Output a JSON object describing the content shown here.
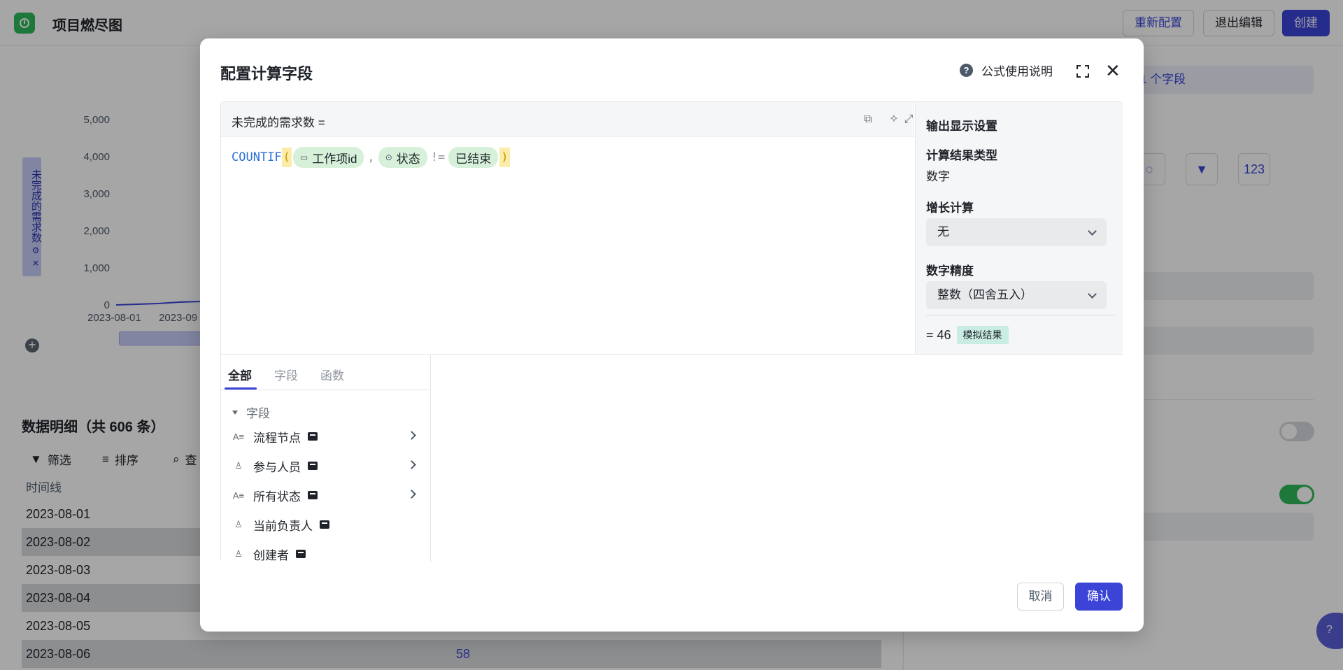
{
  "app": {
    "title": "项目燃尽图",
    "reconfigure_label": "重新配置",
    "exit_edit_label": "退出编辑",
    "create_label": "创建"
  },
  "chart": {
    "y_axis_label": "未完成的需求数",
    "y_ticks": [
      "5,000",
      "4,000",
      "3,000",
      "2,000",
      "1,000",
      "0"
    ],
    "x_ticks": [
      "2023-08-01",
      "2023-09"
    ]
  },
  "details": {
    "title": "数据明细（共 606 条）",
    "toolbar": {
      "filter_label": "筛选",
      "sort_label": "排序",
      "view_label": "查"
    },
    "column_header": "时间线",
    "rows": [
      {
        "date": "2023-08-01",
        "value": ""
      },
      {
        "date": "2023-08-02",
        "value": ""
      },
      {
        "date": "2023-08-03",
        "value": ""
      },
      {
        "date": "2023-08-04",
        "value": ""
      },
      {
        "date": "2023-08-05",
        "value": ""
      },
      {
        "date": "2023-08-06",
        "value": "58"
      }
    ]
  },
  "right_panel": {
    "field_pill": "1 个字段"
  },
  "modal": {
    "title": "配置计算字段",
    "help_label": "公式使用说明",
    "formula": {
      "name_label": "未完成的需求数 =",
      "function": "COUNTIF",
      "open_paren": "(",
      "close_paren": ")",
      "arg1": "工作项id",
      "comma": ",",
      "arg2": "状态",
      "operator": "!=",
      "arg3": "已结束"
    },
    "settings": {
      "title": "输出显示设置",
      "result_type_label": "计算结果类型",
      "result_type_value": "数字",
      "growth_label": "增长计算",
      "growth_value": "无",
      "precision_label": "数字精度",
      "precision_value": "整数（四舍五入）",
      "result_prefix": "= 46",
      "simulate_badge": "模拟结果"
    },
    "tabs": [
      "全部",
      "字段",
      "函数"
    ],
    "group_title": "字段",
    "fields": [
      {
        "label": "流程节点",
        "type_icon": "list-text-icon",
        "has_arrow": true
      },
      {
        "label": "参与人员",
        "type_icon": "person-icon",
        "has_arrow": true
      },
      {
        "label": "所有状态",
        "type_icon": "list-text-icon",
        "has_arrow": true
      },
      {
        "label": "当前负责人",
        "type_icon": "person-icon",
        "has_arrow": false
      },
      {
        "label": "创建者",
        "type_icon": "person-icon",
        "has_arrow": false
      }
    ],
    "cancel_label": "取消",
    "confirm_label": "确认"
  },
  "colors": {
    "accent": "#3b44d7",
    "chip_green": "#d6f0d9",
    "paren_yellow": "#fcecaa",
    "badge_teal": "#c9ece3"
  }
}
